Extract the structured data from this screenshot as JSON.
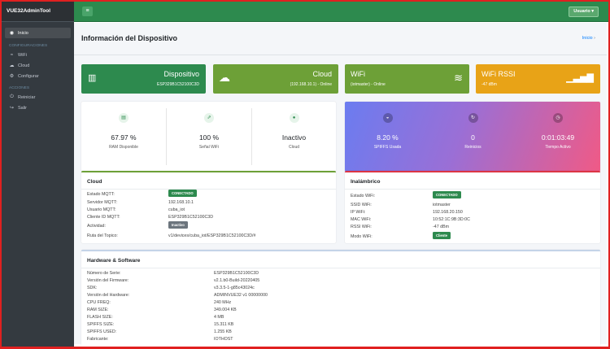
{
  "app": {
    "brand": "VUE32AdminTool",
    "user": "Usuario"
  },
  "sidebar": {
    "items": [
      {
        "label": "Inicio"
      }
    ],
    "header1": "CONFIGURACIONES",
    "config": [
      {
        "label": "WiFi"
      },
      {
        "label": "Cloud"
      },
      {
        "label": "Configurar"
      }
    ],
    "header2": "ACCIONES",
    "actions": [
      {
        "label": "Reiniciar"
      },
      {
        "label": "Salir"
      }
    ]
  },
  "page": {
    "title": "Información del Dispositivo",
    "breadcrumb": "Inicio"
  },
  "boxes": [
    {
      "title": "Dispositivo",
      "sub": "ESP329B1C52100C3D",
      "color": "#2d8a4e"
    },
    {
      "title": "Cloud",
      "sub": "(192.168.10.1) - Online",
      "color": "#6da037"
    },
    {
      "title": "WiFi",
      "sub": "(iotmaster) - Online",
      "color": "#6da037"
    },
    {
      "title": "WiFi RSSI",
      "sub": "-47 dBm",
      "color": "#e8a317"
    }
  ],
  "stats1": [
    {
      "value": "67.97 %",
      "label": "RAM Disponible"
    },
    {
      "value": "100 %",
      "label": "Señal WiFi"
    },
    {
      "value": "Inactivo",
      "label": "Cloud"
    }
  ],
  "stats2": [
    {
      "value": "8.20 %",
      "label": "SPIFFS Usada"
    },
    {
      "value": "0",
      "label": "Reinicios"
    },
    {
      "value": "0:01:03:49",
      "label": "Tiempo Activo"
    }
  ],
  "cloud": {
    "title": "Cloud",
    "rows": [
      {
        "k": "Estado MQTT:",
        "v": "CONECTADO"
      },
      {
        "k": "Servidor MQTT:",
        "v": "192.168.10.1"
      },
      {
        "k": "Usuario MQTT:",
        "v": "cuba_iot"
      },
      {
        "k": "Cliente ID MQTT:",
        "v": "ESP329B1C52100C3D"
      },
      {
        "k": "Actividad:",
        "v": "Inactivo"
      },
      {
        "k": "Ruta del Topico:",
        "v": "v1/devices/cuba_iot/ESP329B1C52100C3D/#"
      }
    ]
  },
  "wifi": {
    "title": "Inalámbrico",
    "rows": [
      {
        "k": "Estado WiFi:",
        "v": "CONECTADO"
      },
      {
        "k": "SSID WiFi:",
        "v": "iotmaster"
      },
      {
        "k": "IP WiFi:",
        "v": "192.168.20.150"
      },
      {
        "k": "MAC WiFi:",
        "v": "10:52:1C:9B:3D:0C"
      },
      {
        "k": "RSSI WiFi:",
        "v": "-47 dBm"
      },
      {
        "k": "Modo WiFi:",
        "v": "Cliente"
      }
    ]
  },
  "hw": {
    "title": "Hardware & Software",
    "rows": [
      {
        "k": "Número de Serie:",
        "v": "ESP329B1C52100C3D"
      },
      {
        "k": "Versión del Firmware:",
        "v": "v2.1.b0-Build-20220405"
      },
      {
        "k": "SDK:",
        "v": "v3.3.5-1-g85c43024c"
      },
      {
        "k": "Versión del Hardware:",
        "v": "ADMINVUE32 v1 00000000"
      },
      {
        "k": "CPU FREQ:",
        "v": "240 MHz"
      },
      {
        "k": "RAM SIZE:",
        "v": "349.004 KB"
      },
      {
        "k": "FLASH SIZE:",
        "v": "4 MB"
      },
      {
        "k": "SPIFFS SIZE:",
        "v": "15.311 KB"
      },
      {
        "k": "SPIFFS USED:",
        "v": "1.255 KB"
      },
      {
        "k": "Fabricante:",
        "v": "IOTHOST"
      }
    ]
  }
}
